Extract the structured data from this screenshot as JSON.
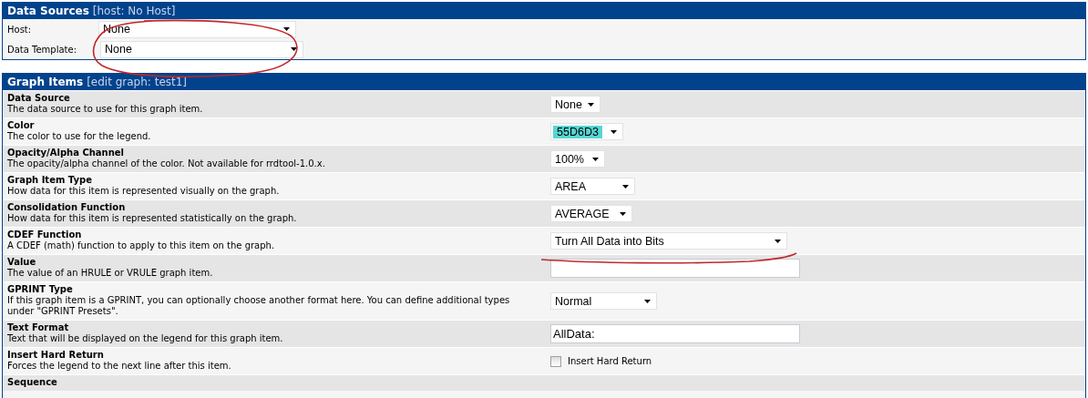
{
  "data_sources": {
    "title": "Data Sources",
    "subtitle": "[host: No Host]",
    "fields": [
      {
        "label": "Host:",
        "value": "None"
      },
      {
        "label": "Data Template:",
        "value": "None"
      }
    ]
  },
  "graph_items": {
    "title": "Graph Items",
    "subtitle": "[edit graph: test1]",
    "rows": [
      {
        "title": "Data Source",
        "description": "The data source to use for this graph item.",
        "kind": "select",
        "value": "None"
      },
      {
        "title": "Color",
        "description": "The color to use for the legend.",
        "kind": "color",
        "value": "55D6D3",
        "color": "#55d6d3"
      },
      {
        "title": "Opacity/Alpha Channel",
        "description": "The opacity/alpha channel of the color. Not available for rrdtool-1.0.x.",
        "kind": "select",
        "value": "100%"
      },
      {
        "title": "Graph Item Type",
        "description": "How data for this item is represented visually on the graph.",
        "kind": "select",
        "value": "AREA"
      },
      {
        "title": "Consolidation Function",
        "description": "How data for this item is represented statistically on the graph.",
        "kind": "select",
        "value": "AVERAGE"
      },
      {
        "title": "CDEF Function",
        "description": "A CDEF (math) function to apply to this item on the graph.",
        "kind": "select",
        "value": "Turn All Data into Bits"
      },
      {
        "title": "Value",
        "description": "The value of an HRULE or VRULE graph item.",
        "kind": "text"
      },
      {
        "title": "GPRINT Type",
        "description": "If this graph item is a GPRINT, you can optionally choose another format here. You can define additional types under \"GPRINT Presets\".",
        "kind": "select",
        "value": "Normal"
      },
      {
        "title": "Text Format",
        "description": "Text that will be displayed on the legend for this graph item.",
        "kind": "text",
        "value": "AllData:"
      },
      {
        "title": "Insert Hard Return",
        "description": "Forces the legend to the next line after this item.",
        "kind": "checkbox",
        "label": "Insert Hard Return",
        "checked": false
      },
      {
        "title": "Sequence",
        "kind": "none"
      }
    ]
  }
}
